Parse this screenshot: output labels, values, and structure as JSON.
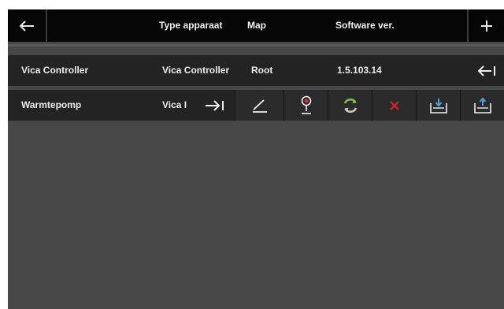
{
  "header": {
    "back_icon": "arrow-left-icon",
    "add_icon": "plus-icon",
    "columns": [
      "Type apparaat",
      "Map",
      "Software ver."
    ]
  },
  "rows": [
    {
      "name": "Vica Controller",
      "type": "Vica Controller",
      "map": "Root",
      "version": "1.5.103.14",
      "action_icon": "collapse-left-icon"
    },
    {
      "name": "Warmtepomp",
      "type_truncated": "Vica I",
      "expand_icon": "expand-right-icon",
      "actions": [
        {
          "name": "edit",
          "icon": "pencil-icon"
        },
        {
          "name": "locate",
          "icon": "map-pin-icon"
        },
        {
          "name": "refresh",
          "icon": "refresh-icon"
        },
        {
          "name": "delete",
          "icon": "close-icon"
        },
        {
          "name": "import",
          "icon": "tray-download-icon"
        },
        {
          "name": "export",
          "icon": "tray-upload-icon"
        }
      ]
    }
  ],
  "colors": {
    "header_bg": "#050505",
    "content_bg": "#474747",
    "row_bg": "#232323",
    "delete_red": "#e0202a",
    "upload_blue": "#4aa3e0",
    "refresh_green": "#7fbf3a",
    "pin_red": "#d9303a"
  }
}
